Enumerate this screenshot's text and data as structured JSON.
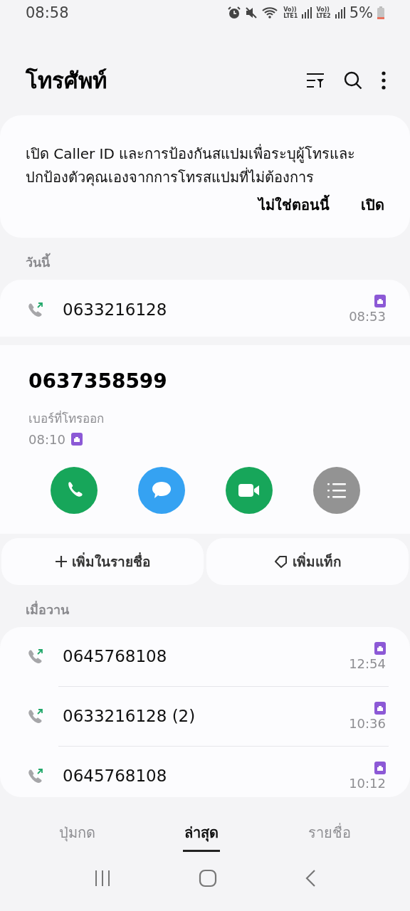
{
  "status_bar": {
    "time": "08:58",
    "sim_labels": [
      {
        "voice": "Vo))",
        "network": "LTE1"
      },
      {
        "voice": "Vo))",
        "network": "LTE2"
      }
    ],
    "battery": "5%"
  },
  "header": {
    "title": "โทรศัพท์"
  },
  "banner": {
    "text": "เปิด Caller ID และการป้องกันสแปมเพื่อระบุผู้โทรและปกป้องตัวคุณเองจากการโทรสแปมที่ไม่ต้องการ",
    "actions": [
      "ไม่ใช่ตอนนี้",
      "เปิด"
    ]
  },
  "sections": [
    {
      "heading": "วันนี้",
      "calls": [
        {
          "kind": "row",
          "number": "0633216128",
          "time": "08:53"
        },
        {
          "kind": "detail",
          "number": "0637358599",
          "call_type": "เบอร์ที่โทรออก",
          "time": "08:10",
          "quick_actions": [
            {
              "kind": "call",
              "color": "#17a65a"
            },
            {
              "kind": "message",
              "color": "#35a2f2"
            },
            {
              "kind": "video",
              "color": "#17a65a"
            },
            {
              "kind": "details",
              "color": "#939393"
            }
          ],
          "buttons": [
            {
              "kind": "add",
              "label": "เพิ่มในรายชื่อ"
            },
            {
              "kind": "tag",
              "label": "เพิ่มแท็ก"
            }
          ]
        }
      ]
    },
    {
      "heading": "เมื่อวาน",
      "calls": [
        {
          "kind": "row",
          "number": "0645768108",
          "time": "12:54"
        },
        {
          "kind": "row",
          "number": "0633216128 (2)",
          "time": "10:36"
        },
        {
          "kind": "row",
          "number": "0645768108",
          "time": "10:12"
        }
      ]
    }
  ],
  "tabs": [
    {
      "label": "ปุ่มกด",
      "selected": false
    },
    {
      "label": "ล่าสุด",
      "selected": true
    },
    {
      "label": "รายชื่อ",
      "selected": false
    }
  ]
}
